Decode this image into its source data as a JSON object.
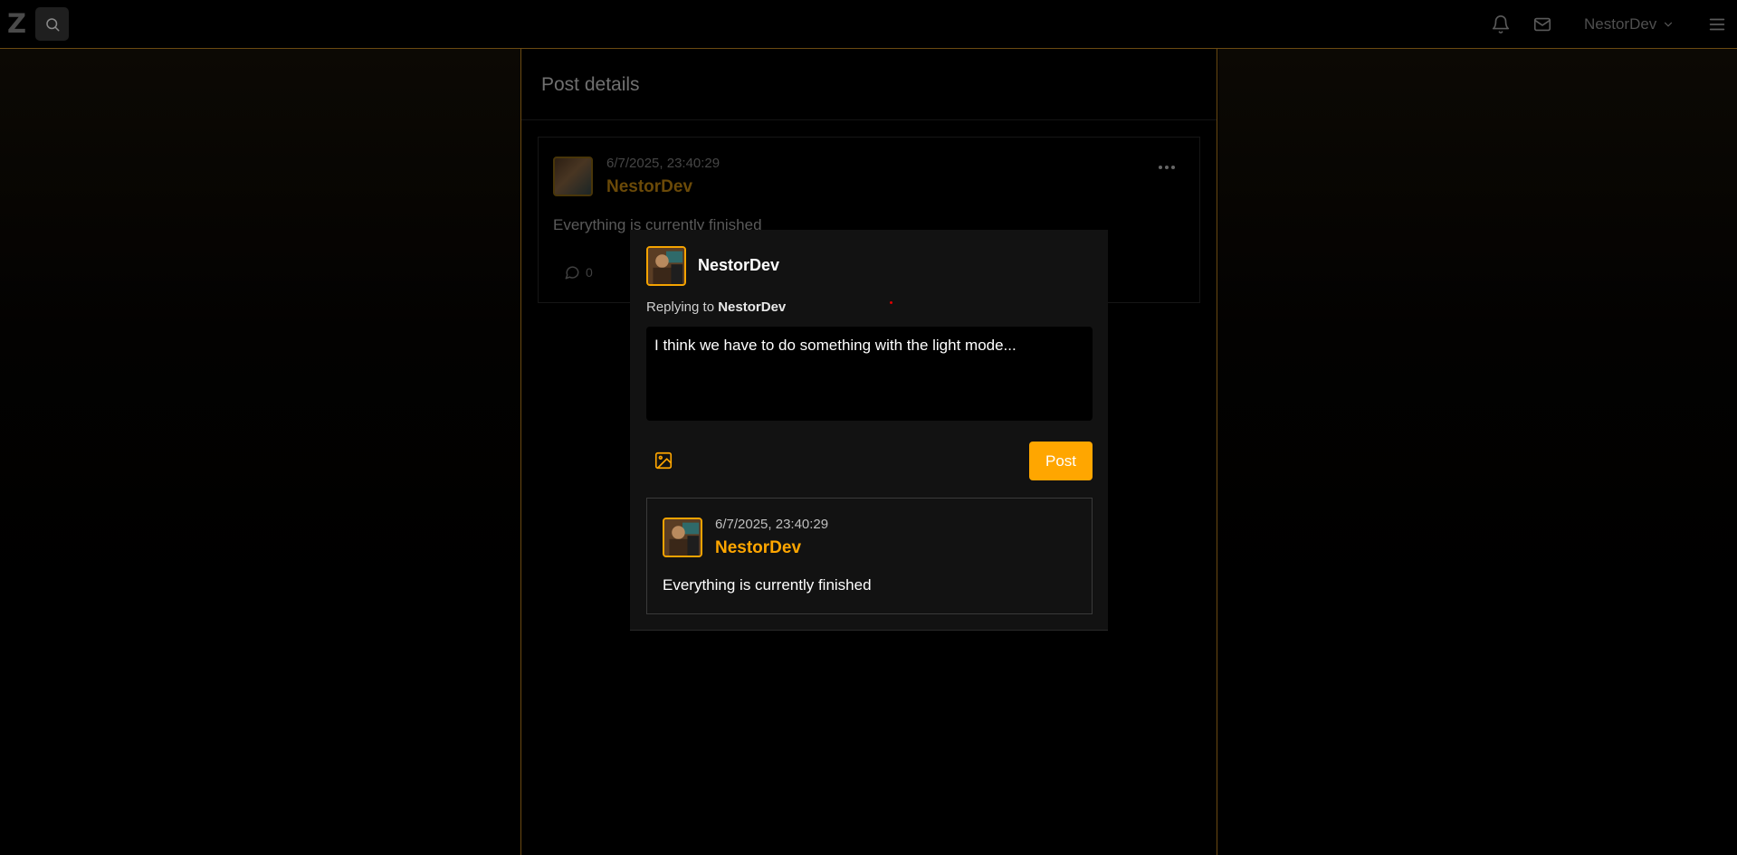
{
  "header": {
    "logo": "Z",
    "user_name": "NestorDev",
    "icons": [
      "search-icon",
      "bell-icon",
      "mail-icon",
      "chevron-down-icon",
      "hamburger-menu-icon"
    ]
  },
  "page": {
    "title": "Post details"
  },
  "background_post": {
    "timestamp": "6/7/2025, 23:40:29",
    "author": "NestorDev",
    "text": "Everything is currently finished",
    "comment_count": "0"
  },
  "reply_modal": {
    "user_name": "NestorDev",
    "replying_prefix": "Replying to",
    "replying_to": "NestorDev",
    "input_value": "I think we have to do something with the light mode...",
    "post_label": "Post",
    "quoted_post": {
      "timestamp": "6/7/2025, 23:40:29",
      "author": "NestorDev",
      "text": "Everything is currently finished"
    }
  },
  "colors": {
    "accent": "#ffa600",
    "background": "#000000",
    "modal_bg": "#121212",
    "border": "#6b4a12"
  }
}
